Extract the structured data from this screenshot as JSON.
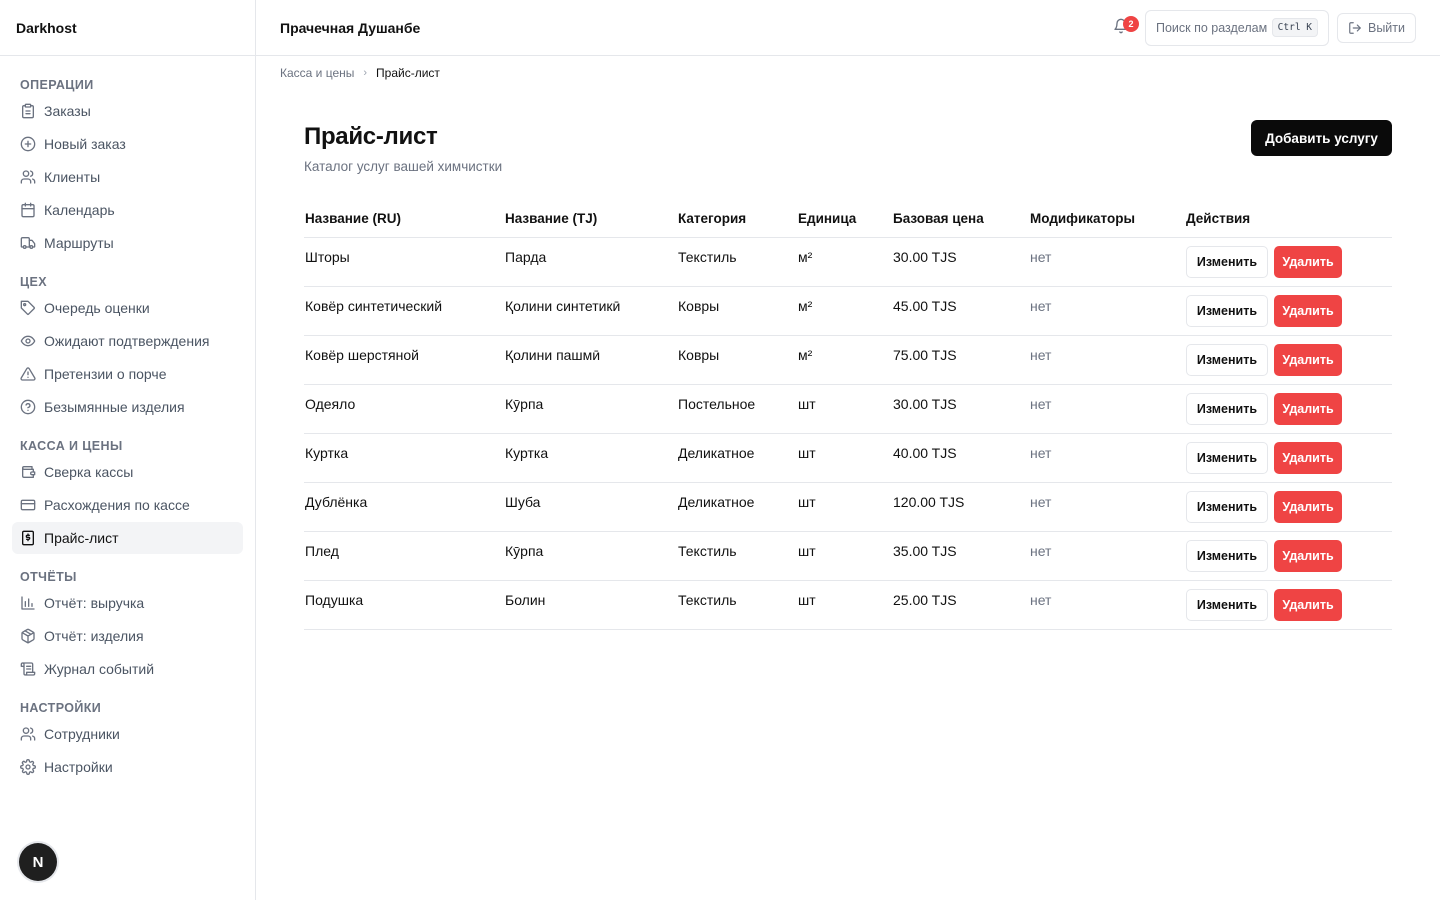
{
  "sidebar": {
    "brand": "Darkhost",
    "sections": [
      {
        "title": "Операции",
        "items": [
          {
            "label": "Заказы",
            "icon": "clipboard-icon"
          },
          {
            "label": "Новый заказ",
            "icon": "plus-circle-icon"
          },
          {
            "label": "Клиенты",
            "icon": "users-icon"
          },
          {
            "label": "Календарь",
            "icon": "calendar-icon"
          },
          {
            "label": "Маршруты",
            "icon": "truck-icon"
          }
        ]
      },
      {
        "title": "Цех",
        "items": [
          {
            "label": "Очередь оценки",
            "icon": "tag-icon"
          },
          {
            "label": "Ожидают подтверждения",
            "icon": "eye-icon"
          },
          {
            "label": "Претензии о порче",
            "icon": "warning-triangle-icon"
          },
          {
            "label": "Безымянные изделия",
            "icon": "question-circle-icon"
          }
        ]
      },
      {
        "title": "Касса и цены",
        "items": [
          {
            "label": "Сверка кассы",
            "icon": "wallet-icon"
          },
          {
            "label": "Расхождения по кассе",
            "icon": "credit-card-icon"
          },
          {
            "label": "Прайс-лист",
            "icon": "receipt-icon",
            "active": true
          }
        ]
      },
      {
        "title": "Отчёты",
        "items": [
          {
            "label": "Отчёт: выручка",
            "icon": "bar-chart-icon"
          },
          {
            "label": "Отчёт: изделия",
            "icon": "package-icon"
          },
          {
            "label": "Журнал событий",
            "icon": "scroll-icon"
          }
        ]
      },
      {
        "title": "Настройки",
        "items": [
          {
            "label": "Сотрудники",
            "icon": "users-icon"
          },
          {
            "label": "Настройки",
            "icon": "gear-icon"
          }
        ]
      }
    ],
    "avatar_letter": "N"
  },
  "topbar": {
    "org_name": "Прачечная Душанбе",
    "notifications_count": "2",
    "search_placeholder": "Поиск по разделам",
    "search_shortcut": "Ctrl K",
    "logout_label": "Выйти"
  },
  "breadcrumb": {
    "parent": "Касса и цены",
    "current": "Прайс-лист"
  },
  "page": {
    "title": "Прайс-лист",
    "subtitle": "Каталог услуг вашей химчистки",
    "add_button": "Добавить услугу"
  },
  "table": {
    "columns": [
      "Название (RU)",
      "Название (TJ)",
      "Категория",
      "Единица",
      "Базовая цена",
      "Модификаторы",
      "Действия"
    ],
    "edit_label": "Изменить",
    "delete_label": "Удалить",
    "rows": [
      [
        "Шторы",
        "Парда",
        "Текстиль",
        "м²",
        "30.00 TJS",
        "нет"
      ],
      [
        "Ковёр синтетический",
        "Қолини синтетикӣ",
        "Ковры",
        "м²",
        "45.00 TJS",
        "нет"
      ],
      [
        "Ковёр шерстяной",
        "Қолини пашмӣ",
        "Ковры",
        "м²",
        "75.00 TJS",
        "нет"
      ],
      [
        "Одеяло",
        "Кӯрпа",
        "Постельное",
        "шт",
        "30.00 TJS",
        "нет"
      ],
      [
        "Куртка",
        "Куртка",
        "Деликатное",
        "шт",
        "40.00 TJS",
        "нет"
      ],
      [
        "Дублёнка",
        "Шуба",
        "Деликатное",
        "шт",
        "120.00 TJS",
        "нет"
      ],
      [
        "Плед",
        "Кӯрпа",
        "Текстиль",
        "шт",
        "35.00 TJS",
        "нет"
      ],
      [
        "Подушка",
        "Болин",
        "Текстиль",
        "шт",
        "25.00 TJS",
        "нет"
      ]
    ]
  },
  "colors": {
    "primary": "#0a0a0a",
    "danger": "#ef4444",
    "border": "#e5e7eb",
    "muted": "#6b7280",
    "active_bg": "#f3f4f6"
  }
}
